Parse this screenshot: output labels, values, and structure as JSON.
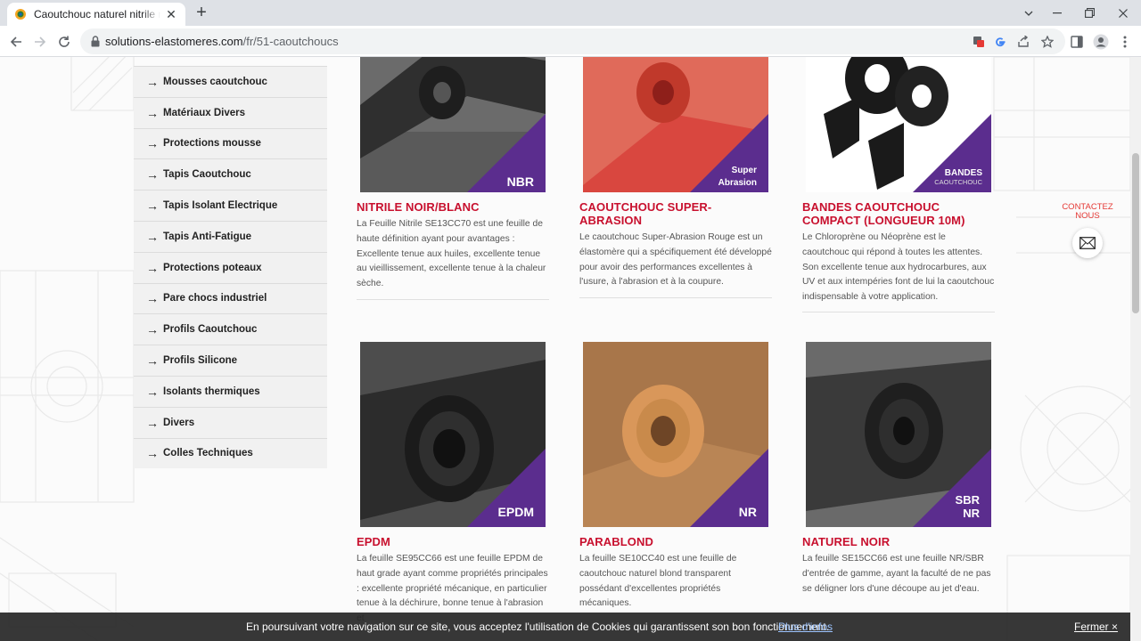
{
  "browser": {
    "tab_title": "Caoutchouc naturel nitrile néoprène",
    "tab_close": "✕",
    "new_tab": "+",
    "url_host": "solutions-elastomeres.com",
    "url_path": "/fr/51-caoutchoucs",
    "minimize": "⌄",
    "icons": [
      "back-icon",
      "forward-icon",
      "reload-icon",
      "lock-icon",
      "translate-icon",
      "google-icon",
      "share-icon",
      "star-icon",
      "sidebar-icon",
      "profile-icon",
      "menu-icon"
    ]
  },
  "sidebar": {
    "items": [
      {
        "label": "Mousses caoutchouc"
      },
      {
        "label": "Matériaux Divers"
      },
      {
        "label": "Protections mousse"
      },
      {
        "label": "Tapis Caoutchouc"
      },
      {
        "label": "Tapis Isolant Electrique"
      },
      {
        "label": "Tapis Anti-Fatigue"
      },
      {
        "label": "Protections poteaux"
      },
      {
        "label": "Pare chocs industriel"
      },
      {
        "label": "Profils Caoutchouc"
      },
      {
        "label": "Profils Silicone"
      },
      {
        "label": "Isolants thermiques"
      },
      {
        "label": "Divers"
      },
      {
        "label": "Colles Techniques"
      }
    ]
  },
  "products": [
    {
      "title": "NITRILE NOIR/BLANC",
      "badge": [
        "NBR"
      ],
      "desc": "La Feuille Nitrile SE13CC70 est une feuille de haute définition ayant pour avantages : Excellente tenue aux huiles, excellente tenue au vieillissement, excellente tenue à la chaleur sèche.",
      "color": "#3a3a3a"
    },
    {
      "title": "CAOUTCHOUC SUPER-ABRASION",
      "badge": [
        "Super",
        "Abrasion"
      ],
      "desc": "Le caoutchouc Super-Abrasion Rouge est un élastomère qui a spécifiquement été développé pour avoir des performances excellentes à l'usure, à l'abrasion et à la coupure.",
      "color": "#d9473f"
    },
    {
      "title": "BANDES CAOUTCHOUC COMPACT (LONGUEUR 10M)",
      "badge": [
        "BANDES",
        "CAOUTCHOUC"
      ],
      "desc": "Le Chloroprène ou Néoprène est le caoutchouc qui répond à toutes les attentes. Son excellente tenue aux hydrocarbures, aux UV et aux intempéries font de lui la caoutchouc indispensable à votre application.",
      "color": "#1a1a1a"
    },
    {
      "title": "EPDM",
      "badge": [
        "EPDM"
      ],
      "desc": "La feuille SE95CC66 est une feuille EPDM de haut grade ayant comme propriétés principales : excellente propriété mécanique, en particulier tenue à la déchirure, bonne tenue à l'abrasion et",
      "color": "#2c2c2c"
    },
    {
      "title": "PARABLOND",
      "badge": [
        "NR"
      ],
      "desc": "La feuille SE10CC40 est une feuille de caoutchouc naturel blond transparent possédant d'excellentes propriétés mécaniques.",
      "color": "#c98a4b"
    },
    {
      "title": "NATUREL NOIR",
      "badge": [
        "SBR",
        "NR"
      ],
      "desc": "La feuille SE15CC66 est une feuille NR/SBR d'entrée de gamme, ayant la faculté de ne pas se déligner lors d'une découpe au jet d'eau.",
      "color": "#2a2a2a"
    }
  ],
  "contact": {
    "line1": "CONTACTEZ",
    "line2": "NOUS",
    "icon": "mail-icon"
  },
  "cookie": {
    "text": "En poursuivant votre navigation sur ce site, vous acceptez l'utilisation de Cookies qui garantissent son bon fonctionnement.",
    "link": "Plus d'infos",
    "close": "Fermer ×"
  }
}
